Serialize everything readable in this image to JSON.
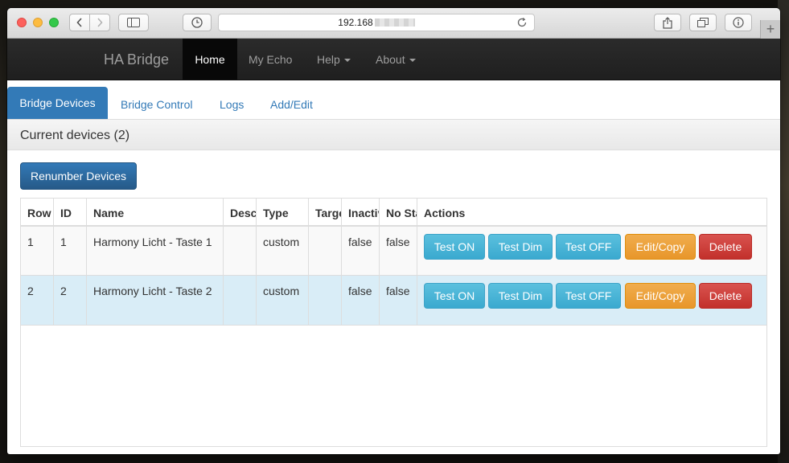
{
  "browser": {
    "url_visible": "192.168",
    "new_tab_label": "+"
  },
  "navbar": {
    "brand": "HA Bridge",
    "items": [
      {
        "label": "Home",
        "active": true
      },
      {
        "label": "My Echo"
      },
      {
        "label": "Help",
        "dropdown": true
      },
      {
        "label": "About",
        "dropdown": true
      }
    ]
  },
  "tabs": [
    {
      "label": "Bridge Devices",
      "active": true
    },
    {
      "label": "Bridge Control"
    },
    {
      "label": "Logs"
    },
    {
      "label": "Add/Edit"
    }
  ],
  "panel": {
    "title": "Current devices (2)",
    "renumber_label": "Renumber Devices"
  },
  "table": {
    "headers": [
      "Row",
      "ID",
      "Name",
      "Description",
      "Type",
      "Target",
      "Inactive",
      "No State",
      "Actions"
    ],
    "rows": [
      {
        "row": "1",
        "id": "1",
        "name": "Harmony Licht - Taste 1",
        "description": "",
        "type": "custom",
        "target": "",
        "inactive": "false",
        "nostate": "false"
      },
      {
        "row": "2",
        "id": "2",
        "name": "Harmony Licht - Taste 2",
        "description": "",
        "type": "custom",
        "target": "",
        "inactive": "false",
        "nostate": "false"
      }
    ],
    "actions": [
      "Test ON",
      "Test Dim",
      "Test OFF",
      "Edit/Copy",
      "Delete"
    ]
  },
  "colors": {
    "primary": "#337ab7",
    "info": "#5bc0de",
    "warning": "#f0ad4e",
    "danger": "#d9534f",
    "navbar": "#222222"
  }
}
